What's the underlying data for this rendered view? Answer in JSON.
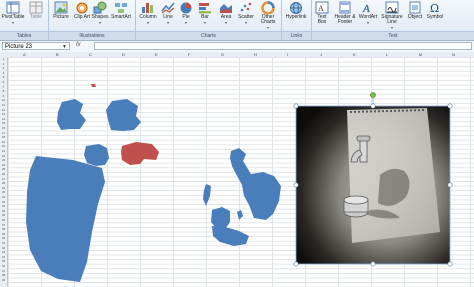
{
  "ribbon": {
    "buttons": [
      {
        "label": "PivotTable",
        "icon": "pivottable-icon"
      },
      {
        "label": "Table",
        "icon": "table-icon"
      },
      {
        "label": "Picture",
        "icon": "picture-icon"
      },
      {
        "label": "Clip Art",
        "icon": "clipart-icon"
      },
      {
        "label": "Shapes",
        "icon": "shapes-icon"
      },
      {
        "label": "SmartArt",
        "icon": "smartart-icon"
      },
      {
        "label": "Column",
        "icon": "column-chart-icon"
      },
      {
        "label": "Line",
        "icon": "line-chart-icon"
      },
      {
        "label": "Pie",
        "icon": "pie-chart-icon"
      },
      {
        "label": "Bar",
        "icon": "bar-chart-icon"
      },
      {
        "label": "Area",
        "icon": "area-chart-icon"
      },
      {
        "label": "Scatter",
        "icon": "scatter-chart-icon"
      },
      {
        "label": "Other Charts",
        "icon": "other-charts-icon"
      },
      {
        "label": "Hyperlink",
        "icon": "hyperlink-icon"
      },
      {
        "label": "Text Box",
        "icon": "textbox-icon"
      },
      {
        "label": "Header & Footer",
        "icon": "header-footer-icon"
      },
      {
        "label": "WordArt",
        "icon": "wordart-icon"
      },
      {
        "label": "Signature Line",
        "icon": "signature-line-icon"
      },
      {
        "label": "Object",
        "icon": "object-icon"
      },
      {
        "label": "Symbol",
        "icon": "symbol-icon"
      }
    ],
    "groups": {
      "tables": "Tables",
      "illustrations": "Illustrations",
      "charts": "Charts",
      "links": "Links",
      "text": "Text"
    }
  },
  "formula_bar": {
    "name_box": "Picture 23",
    "fx": "fx",
    "formula": ""
  },
  "columns": [
    "A",
    "B",
    "C",
    "D",
    "E",
    "F",
    "G",
    "H",
    "I",
    "J",
    "K",
    "L",
    "M",
    "N"
  ],
  "rows": [
    "1",
    "2",
    "3",
    "4",
    "5",
    "6",
    "7",
    "8",
    "9",
    "10",
    "11",
    "12",
    "13",
    "14",
    "15",
    "16",
    "17",
    "18",
    "19",
    "20",
    "21",
    "22",
    "23",
    "24",
    "25",
    "26",
    "27",
    "28",
    "29",
    "30",
    "31",
    "32",
    "33",
    "34",
    "35",
    "36",
    "37",
    "38",
    "39",
    "40",
    "41",
    "42",
    "43",
    "44",
    "45",
    "46",
    "47",
    "48",
    "49"
  ],
  "colors": {
    "shape_blue": "#4a7ebb",
    "shape_red": "#c0504d",
    "selection_handle": "#8bb0d8",
    "rotate_handle": "#7bc043"
  },
  "selected_picture": {
    "description": "faucet-drawing-photo"
  }
}
